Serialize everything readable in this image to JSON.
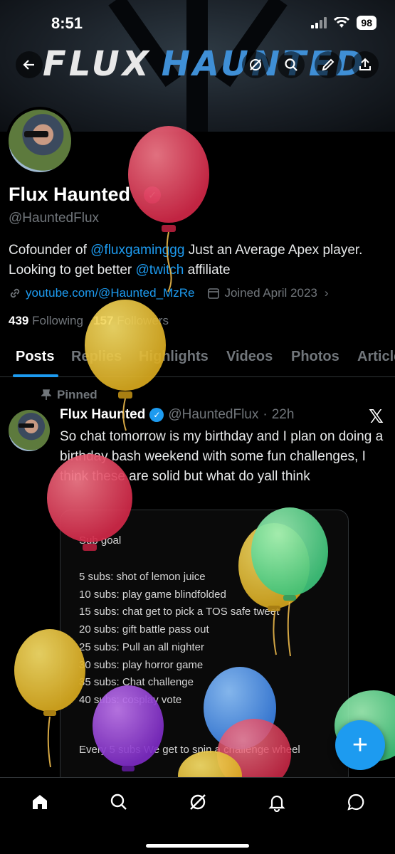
{
  "status_bar": {
    "time": "8:51",
    "battery": "98"
  },
  "banner": {
    "logo_word1": "FLUX",
    "logo_word2": "HAUNTED"
  },
  "profile": {
    "name": "Flux Haunted",
    "handle": "@HauntedFlux",
    "bio_part1": "Cofounder of ",
    "bio_mention1": "@fluxgaminggg",
    "bio_part2": " Just an Average Apex player. Looking to get better ",
    "bio_mention2": "@twitch",
    "bio_part3": " affiliate",
    "website": "youtube.com/@Haunted_MzRe",
    "joined": "Joined April 2023",
    "following_count": "439",
    "following_label": "Following",
    "followers_count": "157",
    "followers_label": "Followers"
  },
  "tabs": [
    "Posts",
    "Replies",
    "Highlights",
    "Videos",
    "Photos",
    "Articles"
  ],
  "post": {
    "pinned_label": "Pinned",
    "author_name": "Flux Haunted",
    "author_handle": "@HauntedFlux",
    "time": "22h",
    "text": "So chat tomorrow is my birthday and I plan on doing a birthday bash weekend with some fun challenges, I think these are solid but what do yall think",
    "card": {
      "title": "Sub goal",
      "lines": [
        "5 subs: shot of lemon juice",
        "10 subs: play game blindfolded",
        "15 subs: chat get to pick a TOS safe tweet",
        "20 subs: gift battle pass out",
        "25 subs: Pull an all nighter",
        "30 subs: play horror game",
        "35 subs: Chat challenge",
        "40 subs: cosplay vote"
      ],
      "footer": "Every 5 subs We get to spin a challenge wheel"
    }
  },
  "fab_label": "+",
  "bottom_nav": [
    "home-icon",
    "search-icon",
    "grok-icon",
    "notifications-icon",
    "messages-icon"
  ],
  "colors": {
    "accent": "#1d9bf0",
    "background": "#000000",
    "muted": "#71767b"
  }
}
